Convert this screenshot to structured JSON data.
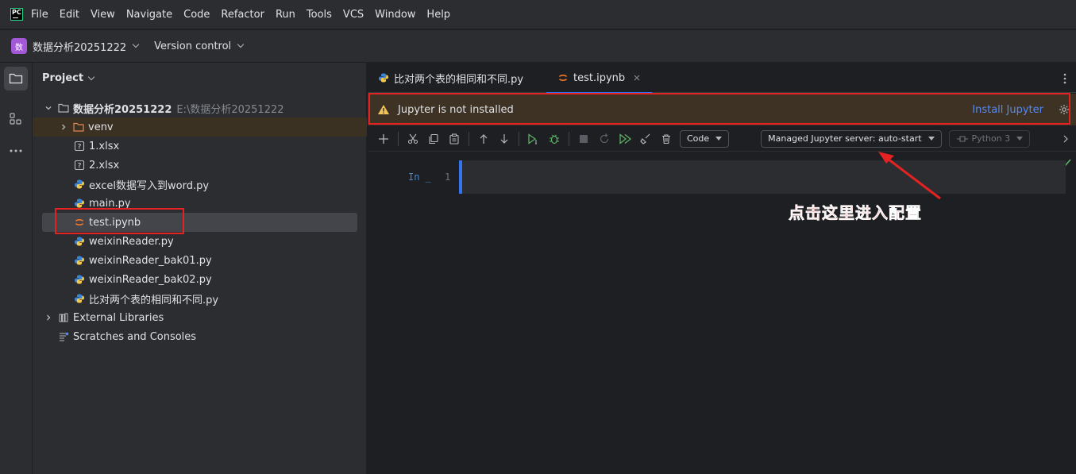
{
  "menubar": {
    "logo_text": "PC",
    "items": [
      "File",
      "Edit",
      "View",
      "Navigate",
      "Code",
      "Refactor",
      "Run",
      "Tools",
      "VCS",
      "Window",
      "Help"
    ]
  },
  "toolbar": {
    "project_badge": "数",
    "project_name": "数据分析20251222",
    "vcs_label": "Version control"
  },
  "project_panel": {
    "title": "Project",
    "root_name": "数据分析20251222",
    "root_path": "E:\\数据分析20251222",
    "items": [
      {
        "label": "venv",
        "type": "folder"
      },
      {
        "label": "1.xlsx",
        "type": "unknown"
      },
      {
        "label": "2.xlsx",
        "type": "unknown"
      },
      {
        "label": "excel数据写入到word.py",
        "type": "python"
      },
      {
        "label": "main.py",
        "type": "python"
      },
      {
        "label": "test.ipynb",
        "type": "notebook"
      },
      {
        "label": "weixinReader.py",
        "type": "python"
      },
      {
        "label": "weixinReader_bak01.py",
        "type": "python"
      },
      {
        "label": "weixinReader_bak02.py",
        "type": "python"
      },
      {
        "label": "比对两个表的相同和不同.py",
        "type": "python"
      }
    ],
    "external_libraries": "External Libraries",
    "scratches": "Scratches and Consoles"
  },
  "editor": {
    "tabs": [
      {
        "label": "比对两个表的相同和不同.py",
        "active": false
      },
      {
        "label": "test.ipynb",
        "active": true
      }
    ],
    "banner_text": "Jupyter is not installed",
    "install_link": "Install Jupyter",
    "cell_type": "Code",
    "server": "Managed Jupyter server: auto-start",
    "kernel": "Python 3",
    "cell_prompt": "In _",
    "cell_line": "1"
  },
  "annotation": "点击这里进入配置",
  "colors": {
    "accent": "#3574f0",
    "highlight": "#e52222",
    "warning": "#f2c55c",
    "link": "#548af7"
  }
}
